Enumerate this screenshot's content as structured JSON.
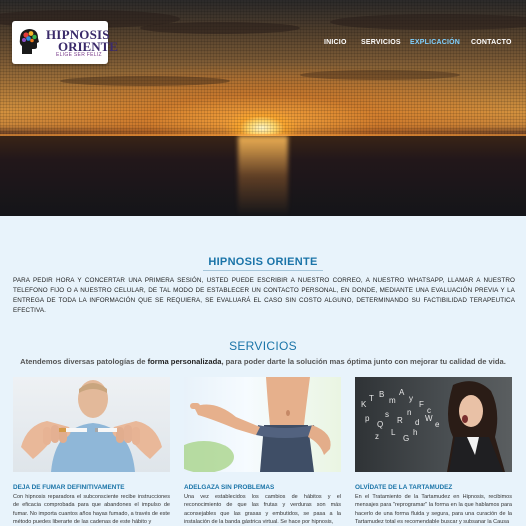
{
  "logo": {
    "line1": "HIPNOSIS",
    "line2": "ORIENTE",
    "tagline": "ELIGE SER FELIZ"
  },
  "nav": {
    "items": [
      {
        "label": "INICIO"
      },
      {
        "label": "SERVICIOS"
      },
      {
        "label": "EXPLICACIÓN"
      },
      {
        "label": "CONTACTO"
      }
    ]
  },
  "about": {
    "title": "HIPNOSIS ORIENTE",
    "text": "PARA PEDIR HORA Y CONCERTAR UNA PRIMERA SESIÓN, USTED PUEDE ESCRIBIR A NUESTRO CORREO, A NUESTRO WHATSAPP, LLAMAR A NUESTRO TELEFONO FIJO O A NUESTRO CELULAR, DE TAL MODO DE ESTABLECER UN CONTACTO PERSONAL, EN DONDE, MEDIANTE UNA EVALUACIÓN PREVIA Y LA ENTREGA DE TODA LA INFORMACIÓN QUE SE REQUIERA, SE EVALUARÁ EL CASO SIN COSTO ALGUNO, DETERMINANDO SU FACTIBILIDAD TERAPEUTICA EFECTIVA."
  },
  "services": {
    "title": "SERVICIOS",
    "sub_pre": "Atendemos diversas patologías de ",
    "sub_bold": "forma personalizada",
    "sub_post": ", para poder darte la solución mas óptima junto con mejorar tu calidad de vida.",
    "cards": [
      {
        "title": "DEJA DE FUMAR DEFINITIVAMENTE",
        "text": "Con hipnosis reparadora el subconsciente recibe instrucciones de eficacia comprobada para que abandones el impulso de fumar. No importa cuantos años hayas fumado, a través de este método puedes liberarte de las cadenas de este hábito y"
      },
      {
        "title": "ADELGAZA SIN PROBLEMAS",
        "text": "Una vez establecidos los cambios de hábitos y el reconocimiento de que las frutas y verduras son más aconsejables que las grasas y embutidos, se pasa a la instalación de la banda gástrica virtual. Se hace por hipnosis,"
      },
      {
        "title": "OLVÍDATE DE LA TARTAMUDEZ",
        "text": "En el Tratamiento de la Tartamudez en Hipnosis, recibimos mensajes para \"reprogramar\" la forma en la que hablamos para hacerlo de una forma fluida y segura, para una curación de la Tartamudez total es recomendable buscar y subsanar la Causa"
      }
    ]
  }
}
